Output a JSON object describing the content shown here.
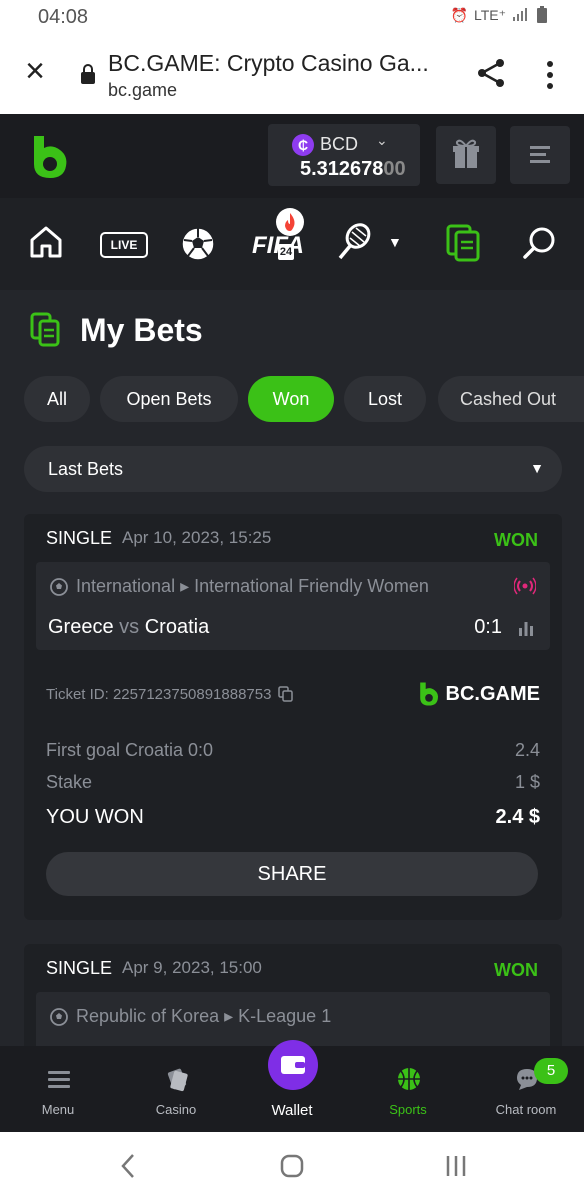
{
  "status_bar": {
    "time": "04:08",
    "net": "LTE⁺"
  },
  "browser": {
    "title": "BC.GAME: Crypto Casino Ga...",
    "domain": "bc.game"
  },
  "header": {
    "currency": "BCD",
    "currency_symbol": "₵",
    "balance_main": "5.312678",
    "balance_dim": "00"
  },
  "sports_nav": {
    "live_label": "LIVE",
    "fifa_label": "FIFA",
    "fifa_sub": "24"
  },
  "page": {
    "title": "My Bets",
    "filters": [
      "All",
      "Open Bets",
      "Won",
      "Lost",
      "Cashed Out"
    ],
    "active_filter": "Won",
    "dropdown": "Last Bets"
  },
  "bets": [
    {
      "type": "SINGLE",
      "date": "Apr 10, 2023, 15:25",
      "status": "WON",
      "league": "International ▸ International Friendly Women",
      "team1": "Greece",
      "vs": "vs",
      "team2": "Croatia",
      "score": "0:1",
      "ticket": "Ticket ID: 2257123750891888753",
      "brand": "BC.GAME",
      "pick_label": "First goal Croatia  0:0",
      "pick_odds": "2.4",
      "stake_label": "Stake",
      "stake_value": "1 $",
      "won_label": "YOU WON",
      "won_value": "2.4 $",
      "share_label": "SHARE"
    },
    {
      "type": "SINGLE",
      "date": "Apr 9, 2023, 15:00",
      "status": "WON",
      "league": "Republic of Korea ▸ K-League 1"
    }
  ],
  "tabbar": {
    "menu": "Menu",
    "casino": "Casino",
    "wallet": "Wallet",
    "sports": "Sports",
    "chat": "Chat room",
    "chat_badge": "5"
  },
  "colors": {
    "accent": "#3bc117",
    "purple": "#7f2ee6",
    "bg": "#24262b"
  }
}
